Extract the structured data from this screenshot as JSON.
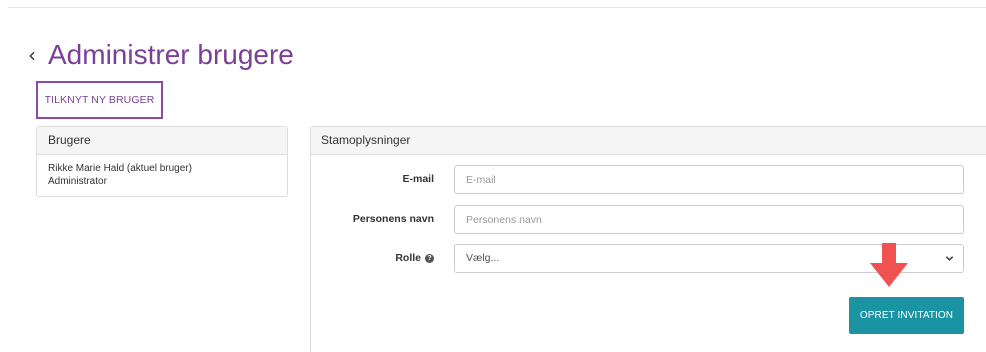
{
  "header": {
    "back_icon": "chevron-left-icon",
    "back_glyph": "‹",
    "title": "Administrer brugere"
  },
  "actions": {
    "link_user_label": "TILKNYT NY BRUGER"
  },
  "users_panel": {
    "heading": "Brugere",
    "users": [
      {
        "name": "Rikke Marie Hald (aktuel bruger)",
        "role": "Administrator"
      }
    ]
  },
  "details_panel": {
    "heading": "Stamoplysninger",
    "email": {
      "label": "E-mail",
      "placeholder": "E-mail",
      "value": ""
    },
    "name": {
      "label": "Personens navn",
      "placeholder": "Personens navn",
      "value": ""
    },
    "role": {
      "label": "Rolle",
      "help_icon": "question-circle-icon",
      "help_glyph": "?",
      "selected": "Vælg...",
      "dropdown_icon": "chevron-down-icon"
    },
    "submit_label": "OPRET INVITATION"
  },
  "annotation": {
    "icon": "arrow-down-icon",
    "color": "#f05252"
  },
  "colors": {
    "title": "#7b3f98",
    "button_border": "#8a4ca8",
    "submit_bg": "#1a94a3"
  }
}
